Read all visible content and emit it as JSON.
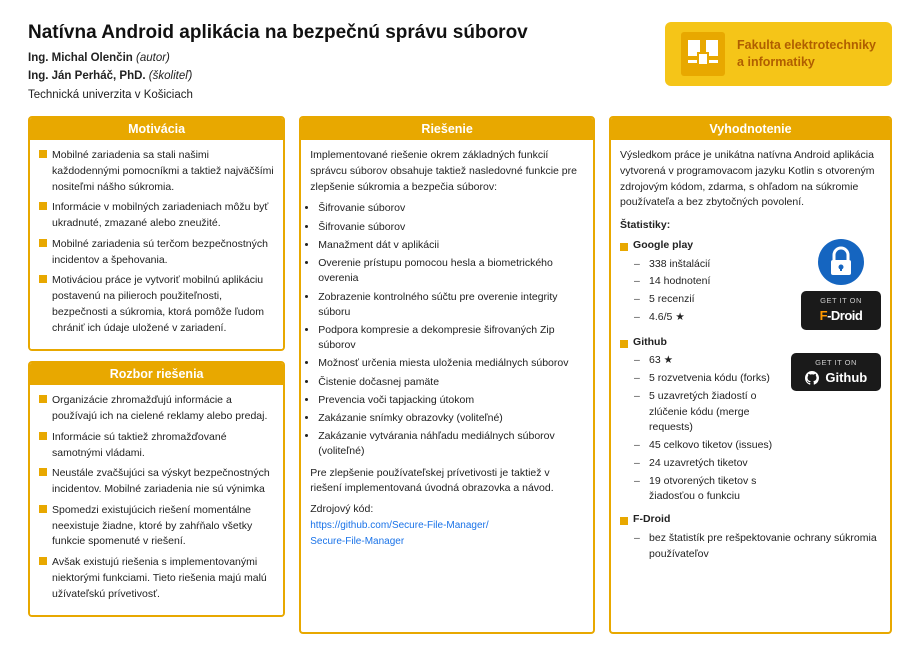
{
  "page": {
    "title": "Natívna Android aplikácia na bezpečnú správu súborov",
    "authors": [
      {
        "name": "Ing. Michal Olenčin",
        "role": "(autor)"
      },
      {
        "name": "Ing. Ján Perháč, PhD.",
        "role": "(školiteľ)"
      }
    ],
    "institution": "Technická univerzita v Košiciach",
    "university": {
      "name": "Fakulta elektrotechniky\na informatiky"
    }
  },
  "motivacia": {
    "header": "Motivácia",
    "items": [
      "Mobilné zariadenia sa stali našimi každodennými pomocníkmi a taktiež najväčšími nositeľmi nášho súkromia.",
      "Informácie v mobilných zariadeniach môžu byť ukradnuté, zmazané alebo zneužité.",
      "Mobilné zariadenia sú terčom bezpečnostných incidentov a špehovania.",
      "Motiváciou práce je vytvoriť mobilnú aplikáciu postavenú na pilieroch použiteľnosti, bezpečnosti a súkromia, ktorá pomôže ľudom chrániť ich údaje uložené v zariadení."
    ]
  },
  "rozbor": {
    "header": "Rozbor riešenia",
    "items": [
      "Organizácie zhromažďujú informácie a používajú ich na cielené reklamy alebo predaj.",
      "Informácie sú taktiež zhromažďované samotnými vládami.",
      "Neustále zvačšujúci sa výskyt bezpečnostných incidentov. Mobilné zariadenia nie sú výnimka",
      "Spomedzi existujúcich riešení momentálne neexistuje žiadne, ktoré by zahŕňalo všetky funkcie spomenuté v riešení.",
      "Avšak existujú riešenia s implementovanými niektorými funkciami. Tieto riešenia majú malú užívateľskú prívetivosť."
    ]
  },
  "riesenie": {
    "header": "Riešenie",
    "intro": "Implementované riešenie okrem základných funkcií správcu súborov obsahuje taktiež nasledovné funkcie pre zlepšenie súkromia a bezpečia súborov:",
    "features": [
      "Šifrovanie súborov",
      "Šifrovanie súborov",
      "Manažment dát v aplikácii",
      "Overenie prístupu pomocou hesla a biometrického overenia",
      "Zobrazenie kontrolného súčtu pre overenie integrity súboru",
      "Podpora kompresie a dekompresie šifrovaných Zip súborov",
      "Možnosť určenia miesta uloženia mediálnych súborov",
      "Čistenie dočasnej pamäte",
      "Prevencia voči tapjacking útokom",
      "Zakázanie snímky obrazovky (voliteľné)",
      "Zakázanie vytvárania náhľadu mediálnych súborov (voliteľné)"
    ],
    "outro": "Pre zlepšenie používateľskej prívetivosti je taktiež v riešení implementovaná úvodná obrazovka a návod.",
    "source_label": "Zdrojový kód:",
    "source_link": "https://github.com/Secure-File-Manager/\nSecure-File-Manager"
  },
  "vyhodnotenie": {
    "header": "Vyhodnotenie",
    "intro": "Výsledkom práce je unikátna natívna Android aplikácia vytvorená v programovacom jazyku Kotlin s otvoreným zdrojovým kódom, zdarma, s ohľadom na súkromie používateľa a bez zbytočných povolení.",
    "stats_label": "Štatistiky:",
    "google_play": {
      "label": "Google play",
      "items": [
        "338 inštalácií",
        "14 hodnotení",
        "5 recenzií",
        "4.6/5 ★"
      ]
    },
    "github": {
      "label": "Github",
      "items": [
        "63 ★",
        "5 rozvetvenia kódu (forks)",
        "5 uzavretých žiadostí o zlúčenie kódu (merge requests)",
        "45 celkovo tiketov (issues)",
        "24 uzavretých tiketov",
        "19 otvorených tiketov s žiadosťou o funkciu"
      ]
    },
    "fdroid": {
      "label": "F-Droid",
      "items": [
        "bez štatistík pre rešpektovanie ochrany súkromia používateľov"
      ]
    }
  }
}
